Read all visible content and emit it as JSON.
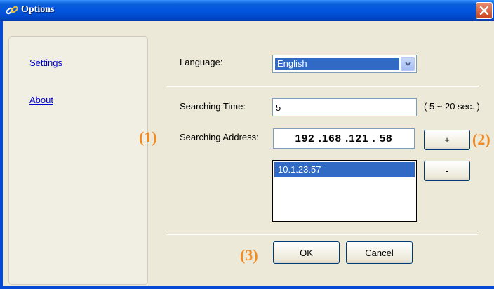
{
  "window": {
    "title": "Options"
  },
  "sidebar": {
    "items": [
      {
        "label": "Settings"
      },
      {
        "label": "About"
      }
    ]
  },
  "language": {
    "label": "Language:",
    "selected": "English"
  },
  "searching_time": {
    "label": "Searching Time:",
    "value": "5",
    "range_hint": "( 5 ~ 20 sec. )"
  },
  "searching_address": {
    "label": "Searching Address:",
    "value": "192 .168 .121 . 58",
    "list": [
      "10.1.23.57"
    ]
  },
  "buttons": {
    "add": "+",
    "remove": "-",
    "ok": "OK",
    "cancel": "Cancel"
  },
  "callouts": [
    "(1)",
    "(2)",
    "(3)"
  ],
  "colors": {
    "titlebar": "#0355e0",
    "selection": "#316ac5",
    "dialog_bg": "#ece9d8",
    "callout": "#f08a24"
  }
}
